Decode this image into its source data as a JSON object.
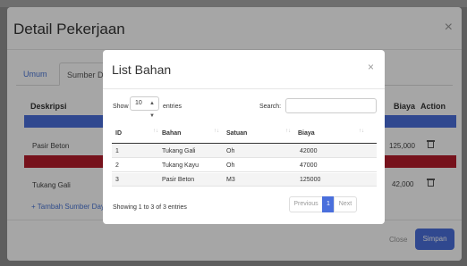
{
  "outer_modal": {
    "title": "Detail Pekerjaan",
    "close_glyph": "×",
    "tabs": [
      {
        "label": "Umum",
        "active": false
      },
      {
        "label": "Sumber Daya",
        "active": true
      }
    ],
    "columns": {
      "deskripsi": "Deskripsi",
      "biaya": "Biaya",
      "action": "Action"
    },
    "rows": [
      {
        "deskripsi": "Pasir Beton",
        "biaya": "125,000",
        "action_icon": "trash-icon"
      },
      {
        "deskripsi": "Tukang Gali",
        "biaya": "42,000",
        "action_icon": "trash-icon"
      }
    ],
    "add_link": "+ Tambah Sumber Daya",
    "footer": {
      "close_label": "Close",
      "save_label": "Simpan"
    },
    "colors": {
      "band_blue": "#4a6fdc",
      "band_red": "#b51c2c",
      "primary": "#4a6fdc"
    }
  },
  "inner_modal": {
    "title": "List Bahan",
    "close_glyph": "×",
    "length": {
      "show": "Show",
      "value": "10",
      "entries": "entries"
    },
    "search": {
      "label": "Search:",
      "value": ""
    },
    "columns": [
      "ID",
      "Bahan",
      "Satuan",
      "Biaya"
    ],
    "rows": [
      {
        "id": "1",
        "bahan": "Tukang Gali",
        "satuan": "Oh",
        "biaya": "42000"
      },
      {
        "id": "2",
        "bahan": "Tukang Kayu",
        "satuan": "Oh",
        "biaya": "47000"
      },
      {
        "id": "3",
        "bahan": "Pasir Beton",
        "satuan": "M3",
        "biaya": "125000"
      }
    ],
    "info": "Showing 1 to 3 of 3 entries",
    "pagination": {
      "previous": "Previous",
      "current": "1",
      "next": "Next"
    }
  }
}
